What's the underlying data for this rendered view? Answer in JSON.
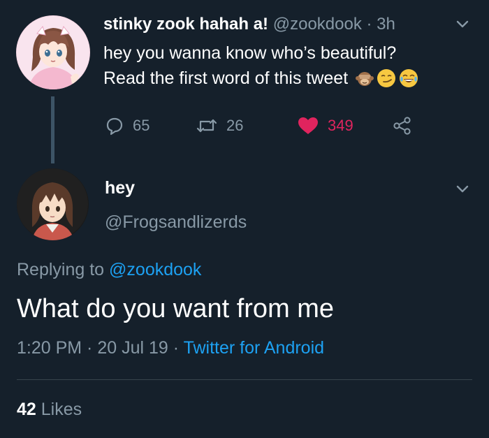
{
  "parent_tweet": {
    "display_name": "stinky zook hahah a!",
    "handle": "@zookdook",
    "separator": " · ",
    "time": "3h",
    "text_line1": "hey you wanna know who’s beautiful?",
    "text_line2": "Read the first word of this tweet",
    "emojis": [
      "see-no-evil-monkey",
      "smirking-face",
      "face-with-tears-of-joy"
    ],
    "actions": {
      "replies": "65",
      "retweets": "26",
      "likes": "349",
      "liked": true,
      "like_color": "#e0245e"
    },
    "avatar_icon": "anime-girl-avatar"
  },
  "reply_tweet": {
    "display_name": "hey",
    "handle": "@Frogsandlizerds",
    "replying_prefix": "Replying to",
    "replying_to": "@zookdook",
    "text": "What do you want from me",
    "time": "1:20 PM",
    "date": "20 Jul 19",
    "separator": " · ",
    "client": "Twitter for Android",
    "likes_count": "42",
    "likes_label": "Likes",
    "avatar_icon": "anime-girl-avatar"
  },
  "colors": {
    "background": "#15202b",
    "text_primary": "#ffffff",
    "text_secondary": "#8899a6",
    "link": "#1da1f2",
    "like": "#e0245e",
    "divider": "#38444d"
  }
}
